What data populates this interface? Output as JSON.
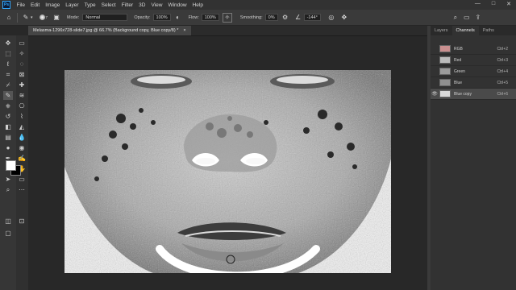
{
  "app": {
    "logo": "Ps",
    "menu": [
      "File",
      "Edit",
      "Image",
      "Layer",
      "Type",
      "Select",
      "Filter",
      "3D",
      "View",
      "Window",
      "Help"
    ],
    "window_controls": [
      "—",
      "□",
      "✕"
    ]
  },
  "options": {
    "mode_label": "Mode:",
    "mode_value": "Normal",
    "opacity_label": "Opacity:",
    "opacity_value": "100%",
    "flow_label": "Flow:",
    "flow_value": "100%",
    "smoothing_label": "Smoothing:",
    "smoothing_value": "0%",
    "angle_value": "-144°",
    "brush_size": "7"
  },
  "document": {
    "tab_title": "Melasma-1296x728-slide7.jpg @ 66.7% (Background copy, Blue copy/8) *",
    "close_glyph": "×"
  },
  "panel": {
    "tabs": [
      "Layers",
      "Channels",
      "Paths"
    ],
    "active_tab": "Channels",
    "channels": [
      {
        "name": "RGB",
        "shortcut": "Ctrl+2",
        "thumb_color": "#c98f8f",
        "visible": false,
        "selected": false
      },
      {
        "name": "Red",
        "shortcut": "Ctrl+3",
        "thumb_color": "#bcbcbc",
        "visible": false,
        "selected": false
      },
      {
        "name": "Green",
        "shortcut": "Ctrl+4",
        "thumb_color": "#9b9b9b",
        "visible": false,
        "selected": false
      },
      {
        "name": "Blue",
        "shortcut": "Ctrl+5",
        "thumb_color": "#8f8f8f",
        "visible": false,
        "selected": false
      },
      {
        "name": "Blue copy",
        "shortcut": "Ctrl+6",
        "thumb_color": "#d8d8d8",
        "visible": true,
        "selected": true
      }
    ]
  },
  "colors": {
    "foreground": "#ffffff",
    "background": "#000000"
  }
}
